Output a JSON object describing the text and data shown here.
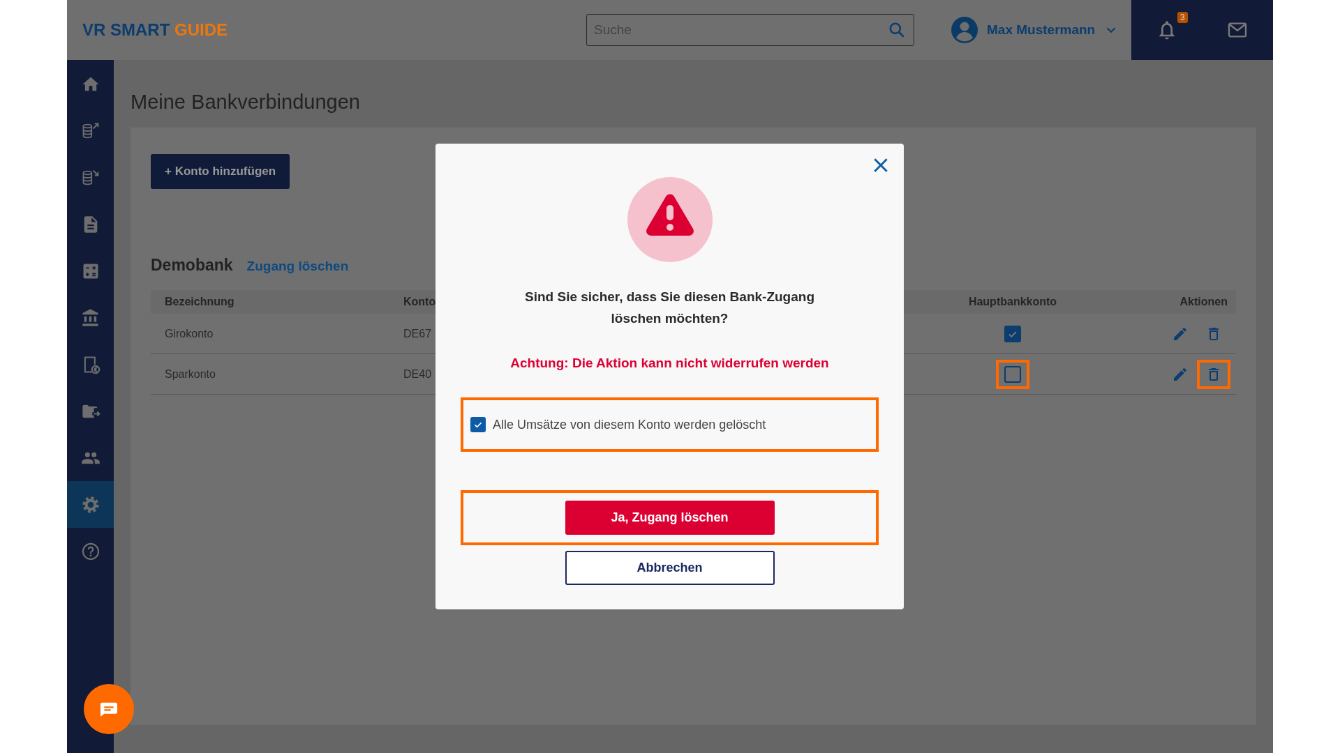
{
  "topbar": {
    "logo": {
      "primary": "VR SMART",
      "accent": "GUIDE"
    },
    "search": {
      "placeholder": "Suche"
    },
    "user": {
      "name": "Max Mustermann"
    },
    "notifications": {
      "badge": "3"
    }
  },
  "sidebar": {
    "items": [
      {
        "kind": "home",
        "selected": false
      },
      {
        "kind": "coins-out",
        "selected": false
      },
      {
        "kind": "coins-in",
        "selected": false
      },
      {
        "kind": "document",
        "selected": false
      },
      {
        "kind": "calculator",
        "selected": false
      },
      {
        "kind": "bank",
        "selected": false
      },
      {
        "kind": "receipt",
        "selected": false
      },
      {
        "kind": "folder",
        "selected": false
      },
      {
        "kind": "people",
        "selected": false
      },
      {
        "kind": "settings",
        "selected": true
      },
      {
        "kind": "help",
        "selected": false
      }
    ]
  },
  "page": {
    "title": "Meine Bankverbindungen",
    "add_button": "+ Konto hinzufügen",
    "bank": {
      "name": "Demobank",
      "delete_link": "Zugang löschen"
    },
    "table": {
      "columns": [
        "Bezeichnung",
        "Konto",
        "Hauptbankkonto",
        "Aktionen"
      ],
      "rows": [
        {
          "name": "Girokonto",
          "account": "DE67",
          "main_account": true,
          "main_highlighted": false,
          "delete_highlighted": false
        },
        {
          "name": "Sparkonto",
          "account": "DE40",
          "main_account": false,
          "main_highlighted": true,
          "delete_highlighted": true
        }
      ]
    }
  },
  "dialog": {
    "question": "Sind Sie sicher, dass Sie diesen Bank-Zugang löschen möchten?",
    "warning": "Achtung: Die Aktion kann nicht widerrufen werden",
    "checkbox": {
      "label": "Alle Umsätze von diesem Konto werden gelöscht",
      "checked": true,
      "highlighted": true
    },
    "confirm_button": "Ja, Zugang löschen",
    "cancel_button": "Abbrechen",
    "buttons_highlighted": true
  }
}
